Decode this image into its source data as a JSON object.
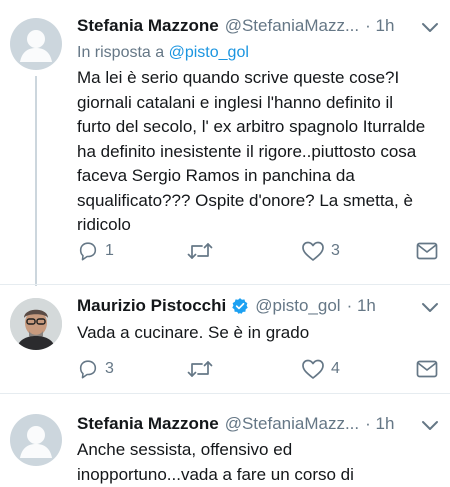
{
  "tweets": [
    {
      "name": "Stefania Mazzone",
      "handle": "@StefaniaMazz...",
      "time": "· 1h",
      "reply_prefix": "In risposta a",
      "reply_mention": "@pisto_gol",
      "text": "Ma lei è serio quando scrive queste cose?I giornali catalani e inglesi l'hanno definito il furto del secolo, l' ex arbitro spagnolo Iturralde ha definito inesistente il rigore..piuttosto cosa faceva Sergio Ramos in panchina da squalificato??? Ospite d'onore? La smetta, è ridicolo",
      "reply_count": "1",
      "retweet_count": "",
      "like_count": "3"
    },
    {
      "name": "Maurizio Pistocchi",
      "handle": "@pisto_gol",
      "time": "· 1h",
      "text": "Vada a cucinare. Se è in grado",
      "reply_count": "3",
      "retweet_count": "",
      "like_count": "4"
    },
    {
      "name": "Stefania Mazzone",
      "handle": "@StefaniaMazz...",
      "time": "· 1h",
      "text": "Anche sessista, offensivo ed\ninopportuno...vada a fare un corso di"
    }
  ],
  "colors": {
    "text": "#14171a",
    "secondary": "#657786",
    "link": "#1b95e0",
    "verified": "#1da1f2",
    "divider": "#e6ecf0",
    "default_avatar": "#ccd6dd"
  },
  "icons": [
    "chevron-down-icon",
    "reply-icon",
    "retweet-icon",
    "like-icon",
    "direct-message-icon",
    "verified-badge-icon",
    "default-avatar-icon"
  ]
}
